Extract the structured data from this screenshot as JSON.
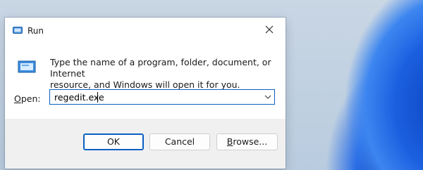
{
  "window": {
    "title": "Run",
    "close_icon": "close-icon",
    "title_icon": "run-icon"
  },
  "content": {
    "prompt_line1": "Type the name of a program, folder, document, or Internet",
    "prompt_line2": "resource, and Windows will open it for you.",
    "open_label_prefix": "O",
    "open_label_rest": "pen:",
    "open_value": "regedit.exe"
  },
  "buttons": {
    "ok": "OK",
    "cancel": "Cancel",
    "browse_prefix": "B",
    "browse_rest": "rowse..."
  },
  "colors": {
    "accent": "#0b5fc4",
    "footer": "#f0f0f0"
  }
}
